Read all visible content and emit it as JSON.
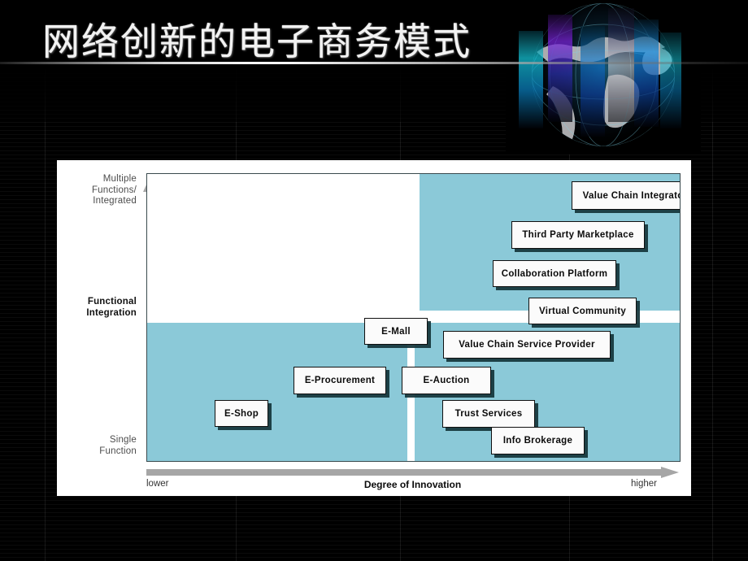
{
  "slide": {
    "title": "网络创新的电子商务模式",
    "background_color": "#000000",
    "panel_color": "#ffffff",
    "accent_teal": "#8bc9d8",
    "graphic_name": "world-map-globe-graphic"
  },
  "chart_data": {
    "type": "scatter",
    "title": "网络创新的电子商务模式",
    "xlabel": "Degree of Innovation",
    "ylabel": "Functional Integration",
    "x_tick_labels": [
      "lower",
      "higher"
    ],
    "y_tick_labels": [
      "Multiple Functions/ Integrated",
      "Functional Integration",
      "Single Function"
    ],
    "y_axis_top_label_lines": [
      "Multiple",
      "Functions/",
      "Integrated"
    ],
    "y_axis_mid_label_lines": [
      "Functional",
      "Integration"
    ],
    "y_axis_bottom_label_lines": [
      "Single",
      "Function"
    ],
    "grid": false,
    "legend": "none",
    "xlim": [
      0,
      100
    ],
    "ylim": [
      0,
      100
    ],
    "regions": [
      {
        "name": "upper-right-teal-region",
        "color": "#8bc9d8"
      },
      {
        "name": "lower-band-teal-region",
        "color": "#8bc9d8"
      }
    ],
    "points": [
      {
        "label": "Value Chain Integrator",
        "x": 82,
        "y": 94
      },
      {
        "label": "Third Party Marketplace",
        "x": 70,
        "y": 81
      },
      {
        "label": "Collaboration Platform",
        "x": 63,
        "y": 68
      },
      {
        "label": "Virtual Community",
        "x": 68,
        "y": 55
      },
      {
        "label": "E-Mall",
        "x": 36,
        "y": 43
      },
      {
        "label": "Value Chain Service Provider",
        "x": 60,
        "y": 40
      },
      {
        "label": "E-Procurement",
        "x": 26,
        "y": 29
      },
      {
        "label": "E-Auction",
        "x": 46,
        "y": 29
      },
      {
        "label": "E-Shop",
        "x": 8,
        "y": 17
      },
      {
        "label": "Trust Services",
        "x": 53,
        "y": 17
      },
      {
        "label": "Info Brokerage",
        "x": 63,
        "y": 7
      }
    ]
  },
  "boxes": [
    {
      "id": "value-chain-integrator",
      "label": "Value Chain Integrator"
    },
    {
      "id": "third-party-marketplace",
      "label": "Third Party Marketplace"
    },
    {
      "id": "collaboration-platform",
      "label": "Collaboration Platform"
    },
    {
      "id": "virtual-community",
      "label": "Virtual Community"
    },
    {
      "id": "e-mall",
      "label": "E-Mall"
    },
    {
      "id": "value-chain-service-provider",
      "label": "Value Chain Service Provider"
    },
    {
      "id": "e-procurement",
      "label": "E-Procurement"
    },
    {
      "id": "e-auction",
      "label": "E-Auction"
    },
    {
      "id": "e-shop",
      "label": "E-Shop"
    },
    {
      "id": "trust-services",
      "label": "Trust Services"
    },
    {
      "id": "info-brokerage",
      "label": "Info Brokerage"
    }
  ],
  "axes": {
    "y_top_l1": "Multiple",
    "y_top_l2": "Functions/",
    "y_top_l3": "Integrated",
    "y_mid_l1": "Functional",
    "y_mid_l2": "Integration",
    "y_bot_l1": "Single",
    "y_bot_l2": "Function",
    "x_left": "lower",
    "x_center": "Degree of Innovation",
    "x_right": "higher"
  }
}
